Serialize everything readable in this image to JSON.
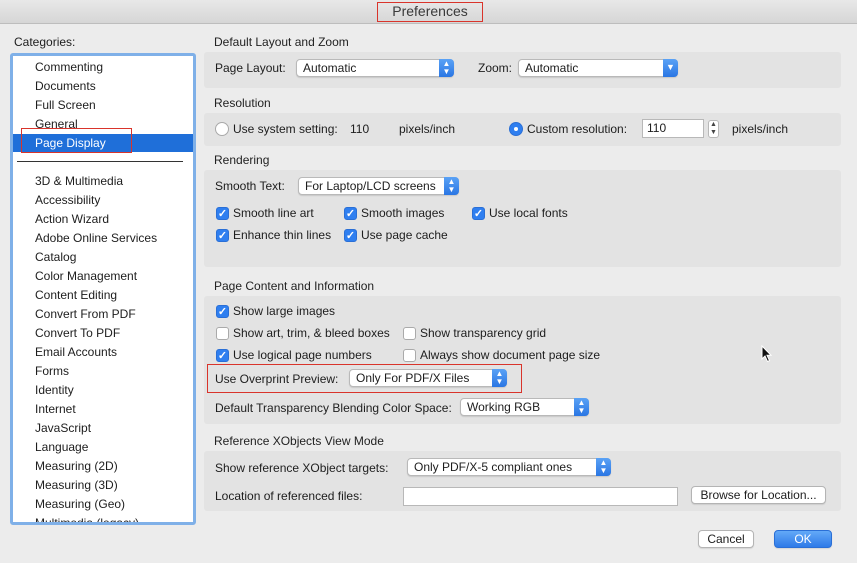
{
  "window": {
    "title": "Preferences"
  },
  "categories": {
    "label": "Categories:",
    "top_items": [
      "Commenting",
      "Documents",
      "Full Screen",
      "General",
      "Page Display"
    ],
    "selected": "Page Display",
    "items": [
      "3D & Multimedia",
      "Accessibility",
      "Action Wizard",
      "Adobe Online Services",
      "Catalog",
      "Color Management",
      "Content Editing",
      "Convert From PDF",
      "Convert To PDF",
      "Email Accounts",
      "Forms",
      "Identity",
      "Internet",
      "JavaScript",
      "Language",
      "Measuring (2D)",
      "Measuring (3D)",
      "Measuring (Geo)",
      "Multimedia (legacy)"
    ]
  },
  "layout_zoom": {
    "title": "Default Layout and Zoom",
    "page_layout_label": "Page Layout:",
    "page_layout_value": "Automatic",
    "zoom_label": "Zoom:",
    "zoom_value": "Automatic"
  },
  "resolution": {
    "title": "Resolution",
    "system_label": "Use system setting:",
    "system_value": "110",
    "system_unit": "pixels/inch",
    "custom_label": "Custom resolution:",
    "custom_value": "110",
    "custom_unit": "pixels/inch",
    "selected": "custom"
  },
  "rendering": {
    "title": "Rendering",
    "smooth_text_label": "Smooth Text:",
    "smooth_text_value": "For Laptop/LCD screens",
    "checkboxes": {
      "smooth_line_art": {
        "label": "Smooth line art",
        "checked": true
      },
      "smooth_images": {
        "label": "Smooth images",
        "checked": true
      },
      "use_local_fonts": {
        "label": "Use local fonts",
        "checked": true
      },
      "enhance_thin_lines": {
        "label": "Enhance thin lines",
        "checked": true
      },
      "use_page_cache": {
        "label": "Use page cache",
        "checked": true
      }
    }
  },
  "page_content": {
    "title": "Page Content and Information",
    "checkboxes": {
      "show_large_images": {
        "label": "Show large images",
        "checked": true
      },
      "show_art_trim": {
        "label": "Show art, trim, & bleed boxes",
        "checked": false
      },
      "show_transparency_grid": {
        "label": "Show transparency grid",
        "checked": false
      },
      "use_logical_page_numbers": {
        "label": "Use logical page numbers",
        "checked": true
      },
      "always_show_doc_page_size": {
        "label": "Always show document page size",
        "checked": false
      }
    },
    "overprint_label": "Use Overprint Preview:",
    "overprint_value": "Only For PDF/X Files",
    "blending_label": "Default Transparency Blending Color Space:",
    "blending_value": "Working RGB"
  },
  "xobjects": {
    "title": "Reference XObjects View Mode",
    "show_targets_label": "Show reference XObject targets:",
    "show_targets_value": "Only PDF/X-5 compliant ones",
    "location_label": "Location of referenced files:",
    "location_value": "",
    "browse_label": "Browse for Location..."
  },
  "footer": {
    "cancel_label": "Cancel",
    "ok_label": "OK"
  },
  "colors": {
    "accent": "#2f7ff0",
    "selection": "#1f6fd9",
    "highlight_box": "#d9342b"
  }
}
